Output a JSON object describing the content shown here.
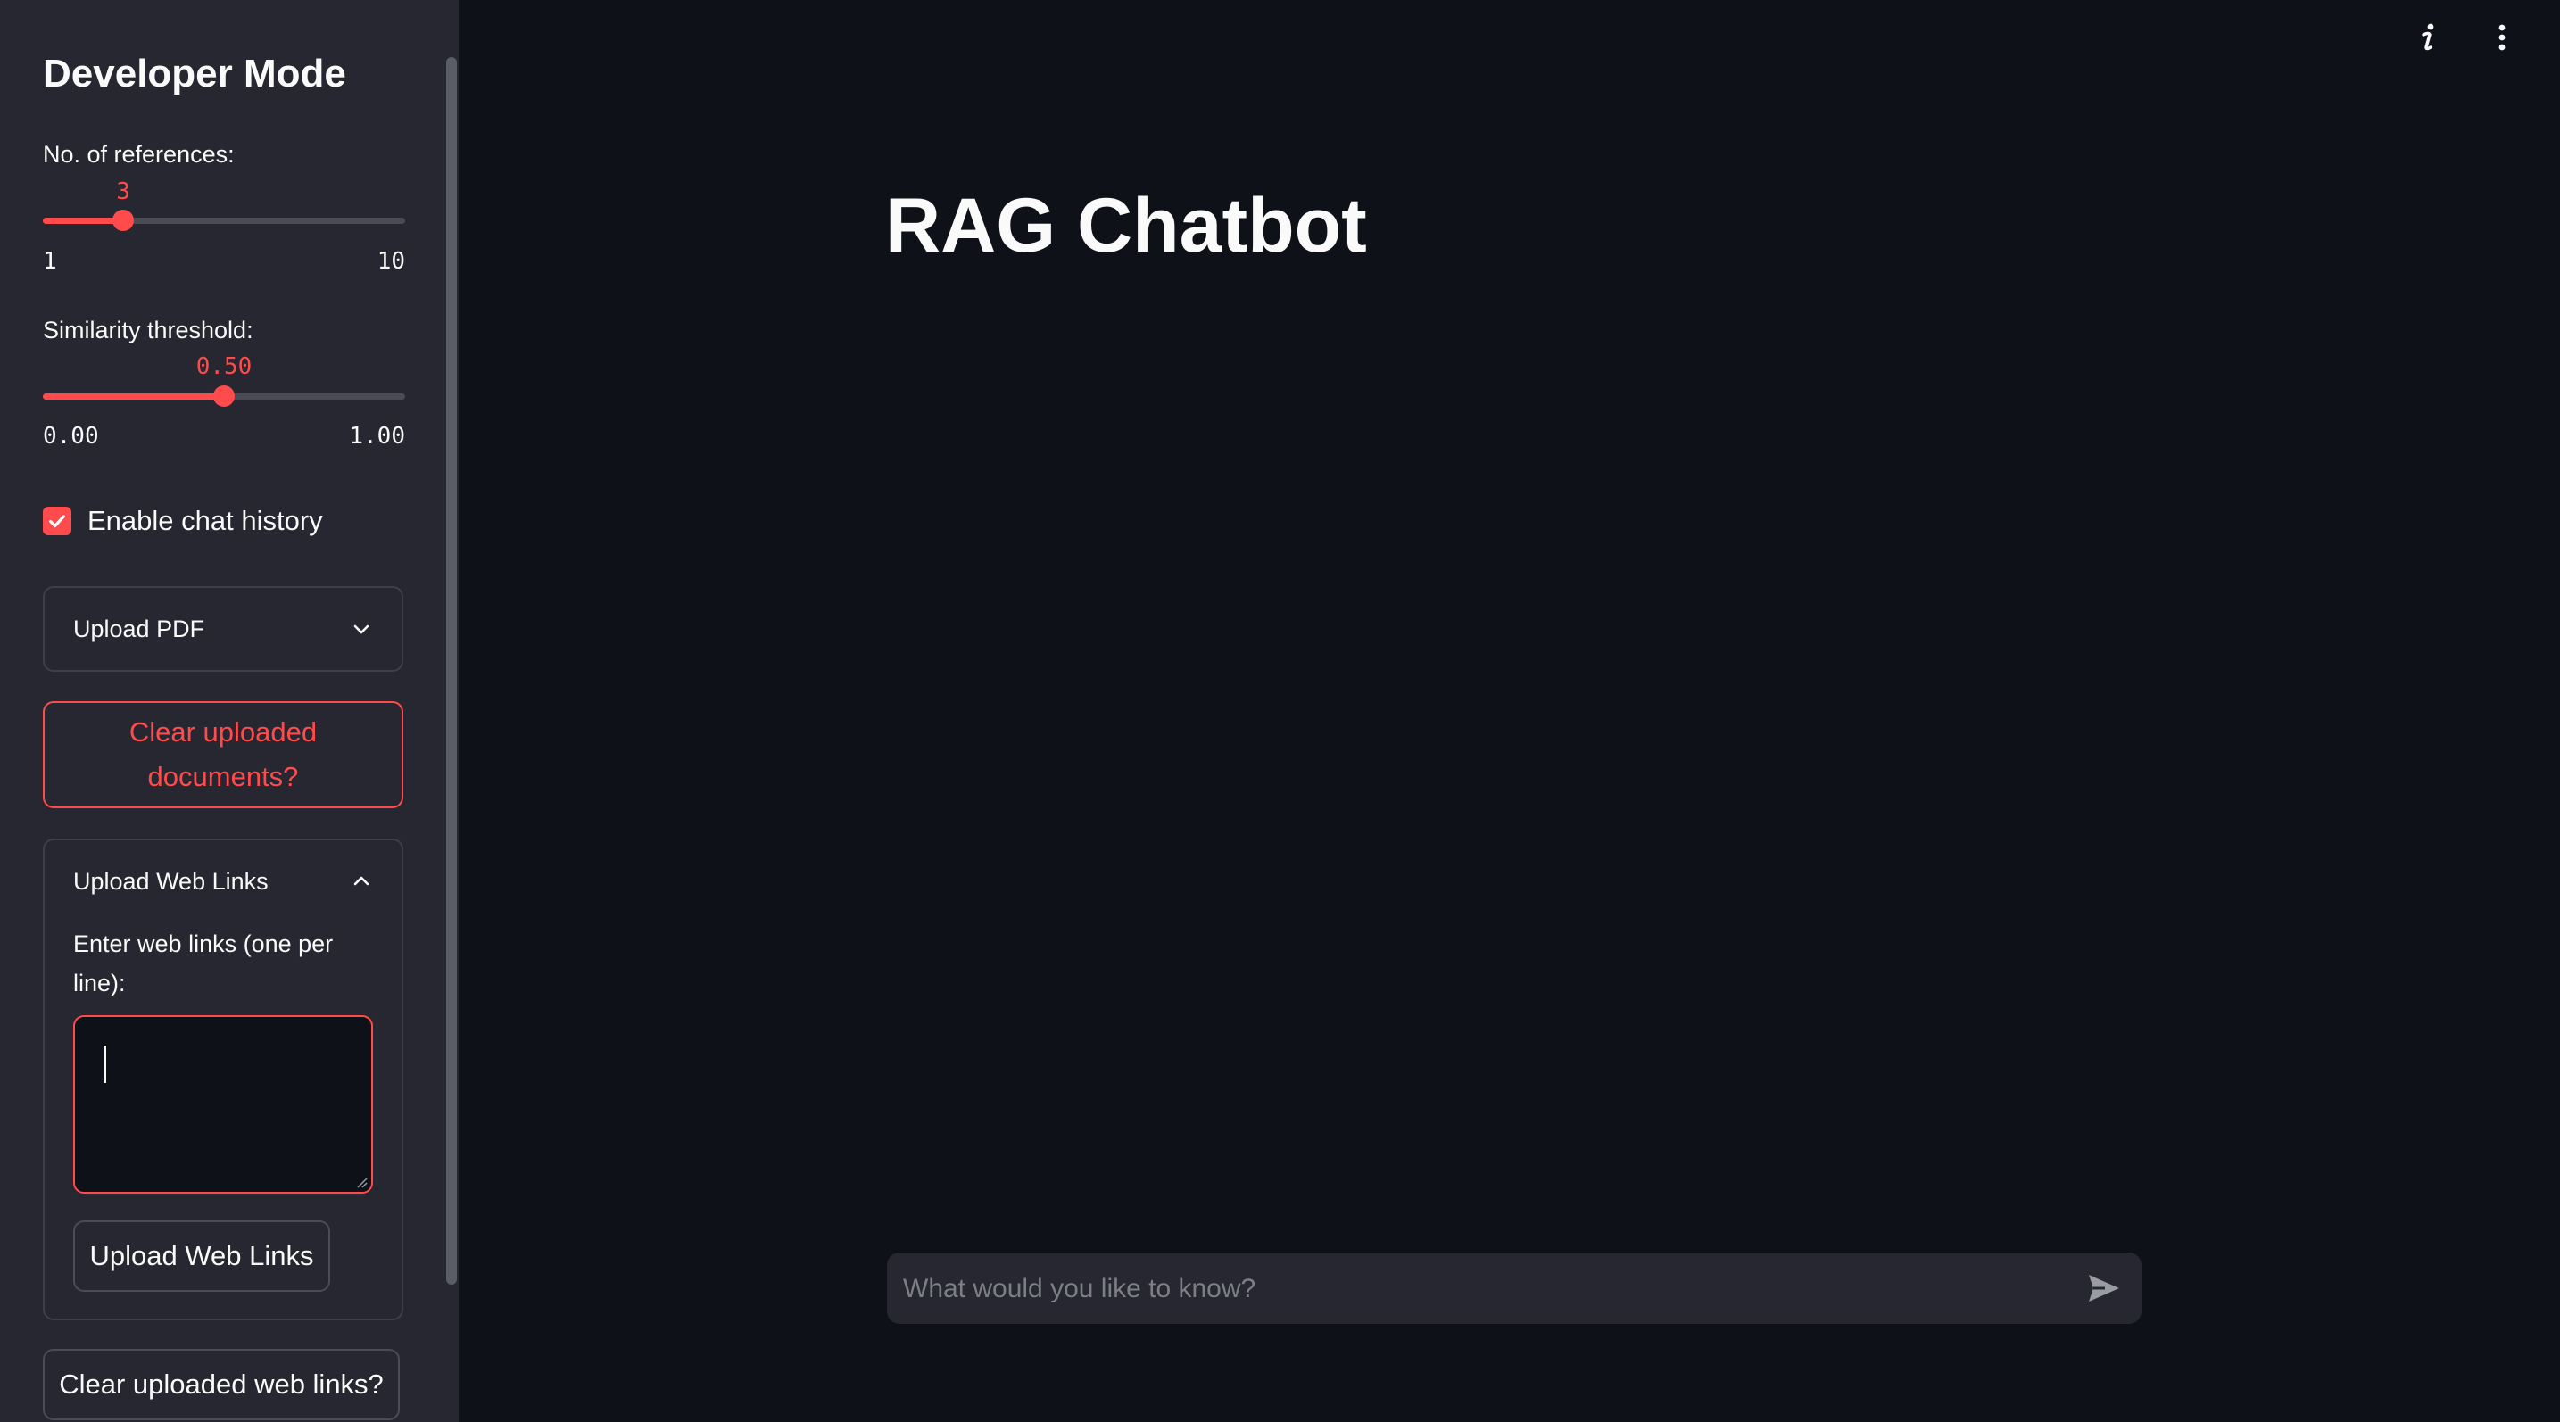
{
  "sidebar": {
    "title": "Developer Mode",
    "references_slider": {
      "label": "No. of references:",
      "value_label": "3",
      "value": 3,
      "min_label": "1",
      "max_label": "10",
      "min": 1,
      "max": 10
    },
    "threshold_slider": {
      "label": "Similarity threshold:",
      "value_label": "0.50",
      "value": 0.5,
      "min_label": "0.00",
      "max_label": "1.00",
      "min": 0,
      "max": 1
    },
    "chat_history_checkbox": {
      "label": "Enable chat history",
      "checked": true
    },
    "upload_pdf_expander": {
      "label": "Upload PDF",
      "expanded": false
    },
    "clear_documents_button": {
      "label": "Clear uploaded documents?"
    },
    "upload_web_links_expander": {
      "label": "Upload Web Links",
      "expanded": true,
      "textarea_label": "Enter web links (one per line):",
      "textarea_value": "",
      "upload_button_label": "Upload Web Links"
    },
    "clear_web_links_button": {
      "label": "Clear uploaded web links?"
    }
  },
  "main": {
    "title": "RAG Chatbot",
    "chat_input": {
      "placeholder": "What would you like to know?",
      "value": ""
    }
  },
  "toolbar": {
    "info_icon": "info-icon",
    "menu_icon": "more-vertical-icon"
  },
  "colors": {
    "accent": "#ff4b4b",
    "sidebar_bg": "#262730",
    "main_bg": "#0e1117",
    "text": "#fafafa"
  }
}
